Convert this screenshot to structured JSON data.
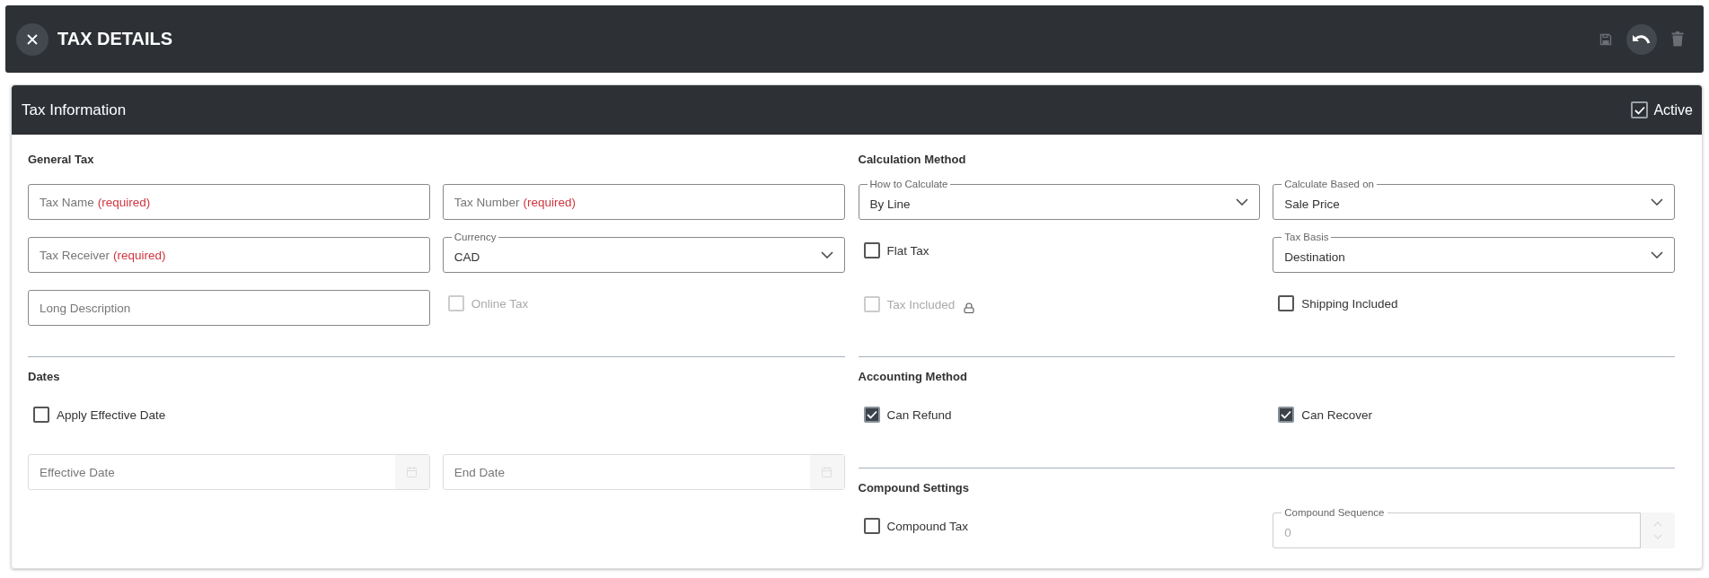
{
  "header": {
    "title": "TAX DETAILS",
    "actions": [
      {
        "kind": "save",
        "disabled": true
      },
      {
        "kind": "undo",
        "disabled": false
      },
      {
        "kind": "delete",
        "disabled": true
      }
    ]
  },
  "card": {
    "title": "Tax Information",
    "active": {
      "label": "Active",
      "checked": true
    }
  },
  "columns": [
    {
      "sections": [
        {
          "title": "General Tax",
          "rows": [
            [
              {
                "kind": "text",
                "placeholder": "Tax Name",
                "required_note": "(required)"
              },
              {
                "kind": "text",
                "placeholder": "Tax Number",
                "required_note": "(required)"
              }
            ],
            [
              {
                "kind": "text",
                "placeholder": "Tax Receiver",
                "required_note": "(required)"
              },
              {
                "kind": "select",
                "label": "Currency",
                "value": "CAD"
              }
            ],
            [
              {
                "kind": "text",
                "placeholder": "Long Description"
              },
              {
                "kind": "checkbox",
                "label": "Online Tax",
                "checked": false,
                "disabled": true
              }
            ]
          ]
        },
        {
          "title": "Dates",
          "rows": [
            [
              {
                "kind": "checkbox",
                "label": "Apply Effective Date",
                "checked": false,
                "disabled": false
              }
            ],
            [
              {
                "kind": "date",
                "placeholder": "Effective Date",
                "disabled": true
              },
              {
                "kind": "date",
                "placeholder": "End Date",
                "disabled": true
              }
            ]
          ]
        }
      ]
    },
    {
      "sections": [
        {
          "title": "Calculation Method",
          "rows": [
            [
              {
                "kind": "select",
                "label": "How to Calculate",
                "value": "By Line"
              },
              {
                "kind": "select",
                "label": "Calculate Based on",
                "value": "Sale Price"
              }
            ],
            [
              {
                "kind": "checkbox",
                "label": "Flat Tax",
                "checked": false,
                "disabled": false
              },
              {
                "kind": "select",
                "label": "Tax Basis",
                "value": "Destination"
              }
            ],
            [
              {
                "kind": "checkbox",
                "label": "Tax Included",
                "checked": false,
                "disabled": true,
                "locked": true
              },
              {
                "kind": "checkbox",
                "label": "Shipping Included",
                "checked": false,
                "disabled": false
              }
            ]
          ]
        },
        {
          "title": "Accounting Method",
          "rows": [
            [
              {
                "kind": "checkbox",
                "label": "Can Refund",
                "checked": true,
                "disabled": false
              },
              {
                "kind": "checkbox",
                "label": "Can Recover",
                "checked": true,
                "disabled": false
              }
            ]
          ]
        },
        {
          "title": "Compound Settings",
          "rows": [
            [
              {
                "kind": "checkbox",
                "label": "Compound Tax",
                "checked": false,
                "disabled": false
              },
              {
                "kind": "number",
                "label": "Compound Sequence",
                "value": "0",
                "disabled": true
              }
            ]
          ]
        }
      ]
    }
  ]
}
